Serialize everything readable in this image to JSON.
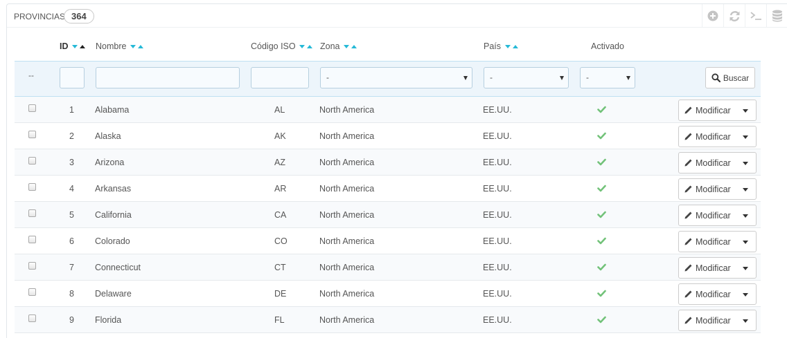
{
  "panel": {
    "title": "PROVINCIAS",
    "count": "364",
    "toolbar": [
      {
        "icon": "add-circle-icon"
      },
      {
        "icon": "refresh-icon"
      },
      {
        "icon": "terminal-icon"
      },
      {
        "icon": "database-icon"
      }
    ]
  },
  "columns": {
    "id": "ID",
    "name": "Nombre",
    "iso": "Código ISO",
    "zone": "Zona",
    "country": "País",
    "active": "Activado"
  },
  "filters": {
    "dash": "--",
    "zone_value": "-",
    "country_value": "-",
    "active_value": "-",
    "search_label": "Buscar"
  },
  "row_action": {
    "edit_label": "Modificar"
  },
  "rows": [
    {
      "id": "1",
      "name": "Alabama",
      "iso": "AL",
      "zone": "North America",
      "country": "EE.UU.",
      "active": true
    },
    {
      "id": "2",
      "name": "Alaska",
      "iso": "AK",
      "zone": "North America",
      "country": "EE.UU.",
      "active": true
    },
    {
      "id": "3",
      "name": "Arizona",
      "iso": "AZ",
      "zone": "North America",
      "country": "EE.UU.",
      "active": true
    },
    {
      "id": "4",
      "name": "Arkansas",
      "iso": "AR",
      "zone": "North America",
      "country": "EE.UU.",
      "active": true
    },
    {
      "id": "5",
      "name": "California",
      "iso": "CA",
      "zone": "North America",
      "country": "EE.UU.",
      "active": true
    },
    {
      "id": "6",
      "name": "Colorado",
      "iso": "CO",
      "zone": "North America",
      "country": "EE.UU.",
      "active": true
    },
    {
      "id": "7",
      "name": "Connecticut",
      "iso": "CT",
      "zone": "North America",
      "country": "EE.UU.",
      "active": true
    },
    {
      "id": "8",
      "name": "Delaware",
      "iso": "DE",
      "zone": "North America",
      "country": "EE.UU.",
      "active": true
    },
    {
      "id": "9",
      "name": "Florida",
      "iso": "FL",
      "zone": "North America",
      "country": "EE.UU.",
      "active": true
    }
  ],
  "colors": {
    "sort_arrow": "#25b9d7",
    "check": "#72c279",
    "filter_bg": "#edf5fb"
  }
}
